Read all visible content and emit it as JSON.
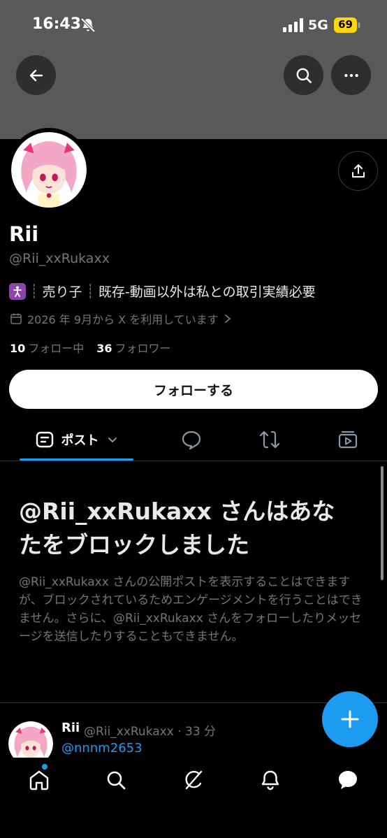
{
  "status_bar": {
    "time": "16:43",
    "network": "5G",
    "battery": "69"
  },
  "colors": {
    "accent": "#1d9bf0",
    "banner": "#595959",
    "battery": "#ffd60a"
  },
  "profile": {
    "name": "Rii",
    "handle": "@Rii_xxRukaxx",
    "bio": {
      "emoji_icon": "person-icon",
      "part1": "売り子",
      "part2": "既存-動画以外は私との取引実績必要",
      "separator": "┊"
    },
    "joined": "2026 年 9月から X を利用しています",
    "following_count": "10",
    "following_label": "フォロー中",
    "followers_count": "36",
    "followers_label": "フォロワー",
    "follow_button": "フォローする"
  },
  "tabs": {
    "posts_label": "ポスト"
  },
  "blocked": {
    "title": "@Rii_xxRukaxx さんはあなたをブロックしました",
    "description": "@Rii_xxRukaxx さんの公開ポストを表示することはできますが、ブロックされているためエンゲージメントを行うことはできません。さらに、@Rii_xxRukaxx さんをフォローしたりメッセージを送信したりすることもできません。"
  },
  "post": {
    "name": "Rii",
    "meta": "@Rii_xxRukaxx · 33 分",
    "mention": "@nnnm2653"
  }
}
